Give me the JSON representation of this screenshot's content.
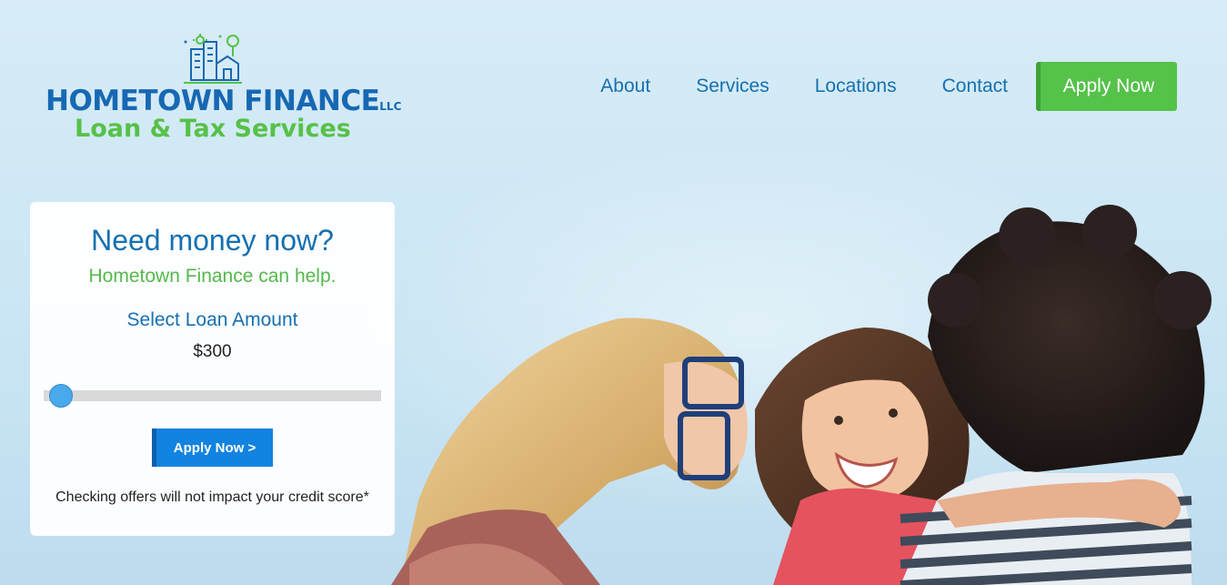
{
  "header": {
    "logo": {
      "line1": "HOMETOWN FINANCE",
      "line1_suffix": "LLC",
      "line2": "Loan & Tax Services"
    },
    "nav": [
      {
        "label": "About"
      },
      {
        "label": "Services"
      },
      {
        "label": "Locations"
      },
      {
        "label": "Contact"
      }
    ],
    "apply_label": "Apply Now"
  },
  "card": {
    "title": "Need money now?",
    "subtitle": "Hometown Finance can help.",
    "select_label": "Select Loan Amount",
    "amount": "$300",
    "slider_fraction": 0.05,
    "apply_label": "Apply Now >",
    "note": "Checking offers will not impact your credit score*"
  },
  "colors": {
    "brand_blue": "#1570b0",
    "brand_green": "#55c24a",
    "button_blue": "#1283e0",
    "slider_thumb": "#49a9eb"
  },
  "icons": {
    "logo_mark": "city-buildings-icon"
  }
}
